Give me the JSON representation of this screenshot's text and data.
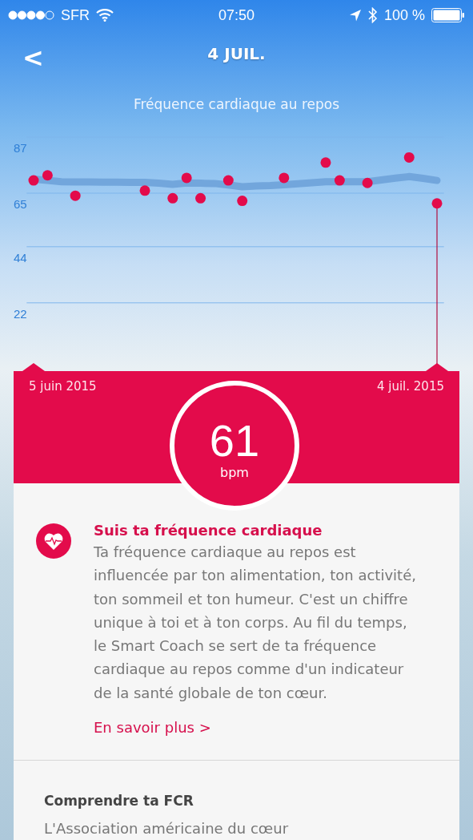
{
  "status_bar": {
    "carrier": "SFR",
    "time": "07:50",
    "battery": "100 %"
  },
  "nav": {
    "back": "<",
    "title": "4 JUIL."
  },
  "chart": {
    "title": "Fréquence cardiaque au repos",
    "chart_data": {
      "type": "scatter",
      "categories": [
        null,
        null,
        null,
        null,
        null,
        null,
        null,
        null,
        null,
        null,
        null,
        null,
        null,
        null,
        null,
        null,
        null,
        null,
        null,
        null,
        null,
        null,
        null,
        null,
        null,
        null,
        null,
        null,
        null,
        null
      ],
      "series": [
        {
          "type": "scatter",
          "color": "#e30b4b",
          "values": [
            70,
            72,
            null,
            64,
            null,
            null,
            null,
            null,
            66,
            null,
            63,
            71,
            63,
            null,
            70,
            62,
            null,
            null,
            71,
            null,
            null,
            77,
            70,
            null,
            69,
            null,
            null,
            79,
            null,
            61
          ]
        },
        {
          "type": "line",
          "color": "#72a6dc",
          "values": [
            70.5,
            70,
            69.5,
            69.4,
            69.4,
            69.3,
            69.3,
            69.2,
            69.2,
            68.9,
            68.5,
            69,
            68.9,
            68.8,
            68.2,
            67.5,
            67.8,
            68,
            68.3,
            68.7,
            69.1,
            69.5,
            69.5,
            69.5,
            69.5,
            70.2,
            70.9,
            71.5,
            70.8,
            70
          ]
        }
      ],
      "ylim": [
        22,
        87
      ],
      "grid": true,
      "yticks": [
        {
          "value": 22,
          "label": "22"
        },
        {
          "value": 44,
          "label": "44"
        },
        {
          "value": 65,
          "label": "65"
        },
        {
          "value": 87,
          "label": "87"
        }
      ]
    },
    "range": {
      "start": "5 juin 2015",
      "end": "4 juil. 2015"
    }
  },
  "reading": {
    "value": "61",
    "unit": "bpm"
  },
  "info": {
    "title": "Suis ta fréquence cardiaque",
    "body": "Ta fréquence cardiaque au repos est influencée par ton alimentation, ton activité, ton sommeil et ton humeur. C'est un chiffre unique à toi et à ton corps. Au fil du temps, le Smart Coach se sert de ta fréquence cardiaque au repos comme d'un indicateur de la santé globale de ton cœur.",
    "link": "En savoir plus >"
  },
  "section": {
    "title": "Comprendre ta FCR",
    "body": "L'Association américaine du cœur"
  }
}
